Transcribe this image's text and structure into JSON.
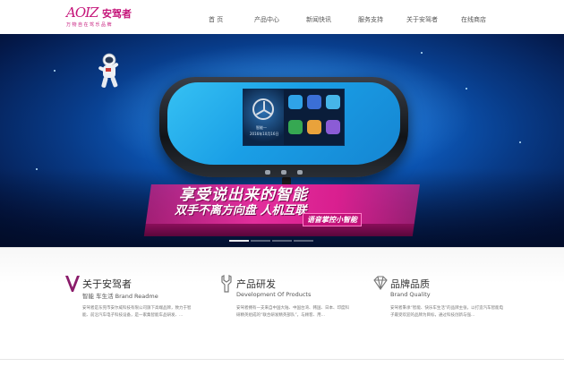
{
  "header": {
    "logo_mark": "AOIZ",
    "logo_cn": "安驾者",
    "logo_slogan": "万物自在驾乐品牌",
    "nav": [
      {
        "label": "首 页"
      },
      {
        "label": "产品中心"
      },
      {
        "label": "新闻快讯"
      },
      {
        "label": "服务支持"
      },
      {
        "label": "关于安驾者"
      },
      {
        "label": "在线商店"
      }
    ]
  },
  "banner": {
    "slogan_main": "享受说出来的智能",
    "slogan_second": "双手不离方向盘  人机互联",
    "slogan_tag": "语音掌控小智能",
    "screen_label": "智能一",
    "screen_date": "2016年10月16日",
    "slides": 4,
    "active_slide": 1
  },
  "sections": [
    {
      "icon": "v-letter-icon",
      "title": "关于安驾者",
      "subtitle": "智能  车生活  Brand Readme",
      "body": "安驾者是东莞市安尔威科技有限公司旗下高端品牌，致力于智能、前沿汽车电子科技设备，是一家集智能车品研发、..."
    },
    {
      "icon": "wrench-icon",
      "title": "产品研发",
      "subtitle": "Development Of Products",
      "body": "安驾者拥有一支来自中国大陆、中国台湾、韩国、日本、印度科研精英组成的“联合研发精英部队”，与顾客、用..."
    },
    {
      "icon": "diamond-icon",
      "title": "品牌品质",
      "subtitle": "Brand Quality",
      "body": "安驾者秉承“智能、快乐车生活”的品牌主张，以打造汽车智能电子最受欢迎的品牌为目标，通过科技创新与强..."
    }
  ],
  "colors": {
    "brand": "#c5157a",
    "banner_dark": "#04194a",
    "banner_light": "#1f9ff0"
  }
}
